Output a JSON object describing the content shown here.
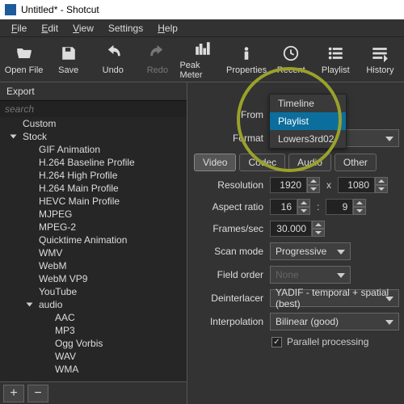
{
  "title": "Untitled* - Shotcut",
  "menu": {
    "file": "File",
    "edit": "Edit",
    "view": "View",
    "settings": "Settings",
    "help": "Help"
  },
  "toolbar": {
    "open": "Open File",
    "save": "Save",
    "undo": "Undo",
    "redo": "Redo",
    "peak": "Peak Meter",
    "properties": "Properties",
    "recent": "Recent",
    "playlist": "Playlist",
    "history": "History"
  },
  "left": {
    "title": "Export",
    "search_placeholder": "search",
    "root1": "Custom",
    "root2": "Stock",
    "stock": [
      "GIF Animation",
      "H.264 Baseline Profile",
      "H.264 High Profile",
      "H.264 Main Profile",
      "HEVC Main Profile",
      "MJPEG",
      "MPEG-2",
      "Quicktime Animation",
      "WMV",
      "WebM",
      "WebM VP9",
      "YouTube"
    ],
    "audio_label": "audio",
    "audio": [
      "AAC",
      "MP3",
      "Ogg Vorbis",
      "WAV",
      "WMA"
    ]
  },
  "right": {
    "from_label": "From",
    "format_label": "Format",
    "format_value": "",
    "menu": {
      "timeline": "Timeline",
      "playlist": "Playlist",
      "lowers": "Lowers3rd02"
    },
    "tabs": {
      "video": "Video",
      "codec": "Codec",
      "audio": "Audio",
      "other": "Other"
    },
    "resolution_label": "Resolution",
    "res_w": "1920",
    "res_h": "1080",
    "x": "x",
    "aspect_label": "Aspect ratio",
    "aspect_a": "16",
    "aspect_b": "9",
    "colon": ":",
    "fps_label": "Frames/sec",
    "fps": "30.000",
    "scan_label": "Scan mode",
    "scan": "Progressive",
    "field_label": "Field order",
    "field": "None",
    "deint_label": "Deinterlacer",
    "deint": "YADIF - temporal + spatial (best)",
    "interp_label": "Interpolation",
    "interp": "Bilinear (good)",
    "parallel": "Parallel processing"
  }
}
